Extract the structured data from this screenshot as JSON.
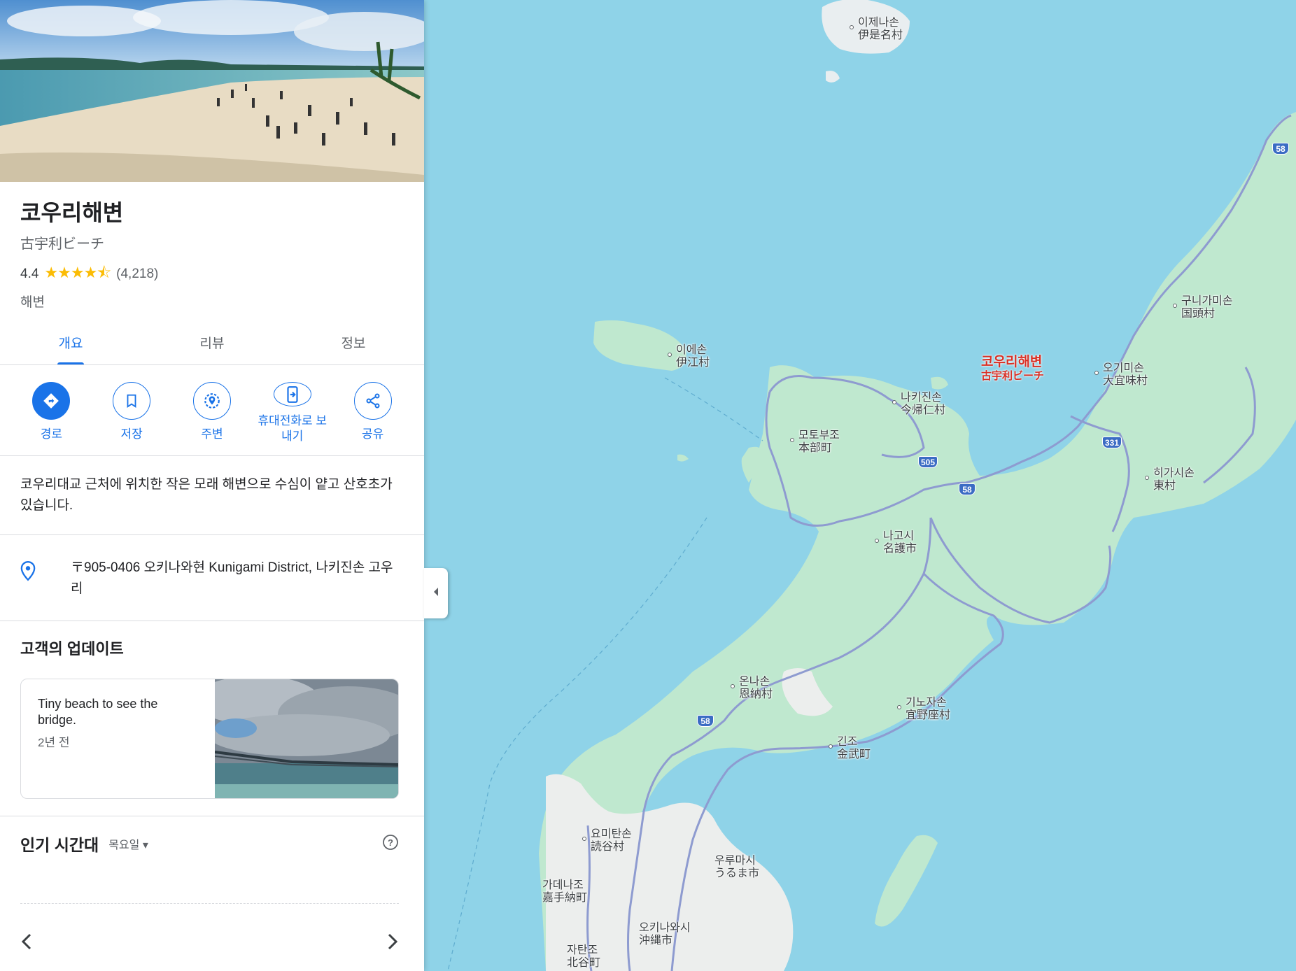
{
  "place": {
    "name": "코우리해변",
    "alt_name": "古宇利ビーチ",
    "rating": "4.4",
    "stars": "★★★★⯪",
    "review_count": "(4,218)",
    "category": "해변"
  },
  "tabs": [
    {
      "label": "개요",
      "active": true
    },
    {
      "label": "리뷰",
      "active": false
    },
    {
      "label": "정보",
      "active": false
    }
  ],
  "actions": [
    {
      "label": "경로",
      "icon": "directions-icon"
    },
    {
      "label": "저장",
      "icon": "bookmark-icon"
    },
    {
      "label": "주변",
      "icon": "nearby-icon"
    },
    {
      "label": "휴대전화로 보내기",
      "icon": "send-to-phone-icon"
    },
    {
      "label": "공유",
      "icon": "share-icon"
    }
  ],
  "description": "코우리대교 근처에 위치한 작은 모래 해변으로 수심이 얕고 산호초가 있습니다.",
  "address": "〒905-0406 오키나와현 Kunigami District, 나키진손 고우리",
  "updates": {
    "title": "고객의 업데이트",
    "card": {
      "text": "Tiny beach to see the bridge.",
      "time": "2년 전"
    }
  },
  "popular_times": {
    "title": "인기 시간대",
    "day": "목요일"
  },
  "map": {
    "marker": {
      "name": "코우리해변",
      "alt": "古宇利ビーチ"
    },
    "places": [
      {
        "ko": "이제나손",
        "ja": "伊是名村"
      },
      {
        "ko": "이에손",
        "ja": "伊江村"
      },
      {
        "ko": "나키진손",
        "ja": "今帰仁村"
      },
      {
        "ko": "모토부조",
        "ja": "本部町"
      },
      {
        "ko": "나고시",
        "ja": "名護市"
      },
      {
        "ko": "구니가미손",
        "ja": "国頭村"
      },
      {
        "ko": "오기미손",
        "ja": "大宜味村"
      },
      {
        "ko": "히가시손",
        "ja": "東村"
      },
      {
        "ko": "온나손",
        "ja": "恩納村"
      },
      {
        "ko": "기노자손",
        "ja": "宜野座村"
      },
      {
        "ko": "긴조",
        "ja": "金武町"
      },
      {
        "ko": "요미탄손",
        "ja": "読谷村"
      },
      {
        "ko": "우루마시",
        "ja": "うるま市"
      },
      {
        "ko": "가데나조",
        "ja": "嘉手納町"
      },
      {
        "ko": "오키나와시",
        "ja": "沖縄市"
      },
      {
        "ko": "자탄조",
        "ja": "北谷町"
      }
    ],
    "routes": [
      "58",
      "331",
      "505",
      "58",
      "58"
    ],
    "colors": {
      "water": "#8fd3e8",
      "land": "#bfe8cf",
      "road": "#8e9bd0",
      "marker": "#d93025"
    }
  }
}
